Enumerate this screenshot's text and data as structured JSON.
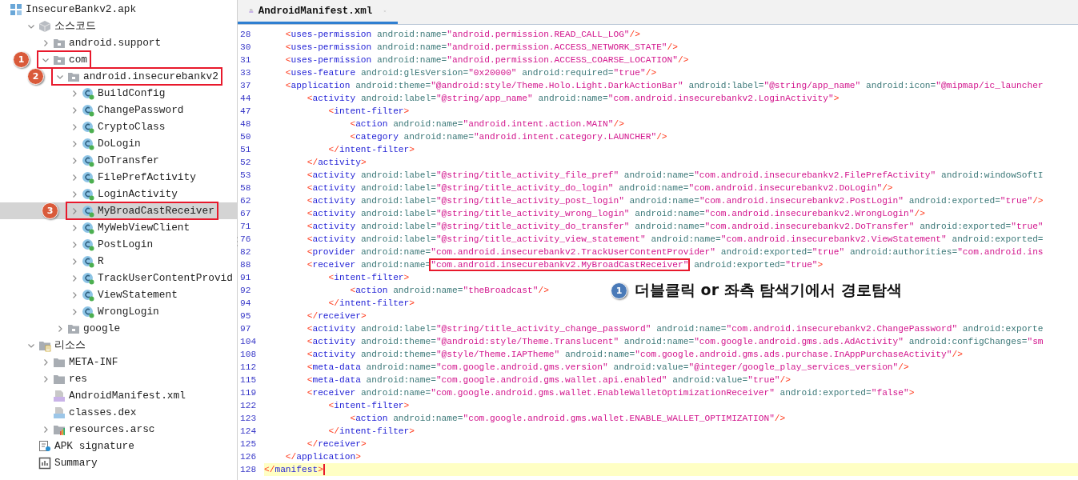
{
  "tree": {
    "label": "InsecureBankv2.apk",
    "kind": "apk",
    "selected": false,
    "children": [
      {
        "label": "소스코드",
        "kind": "sources",
        "selected": false,
        "expanded": true,
        "children": [
          {
            "label": "android.support",
            "kind": "package",
            "selected": false,
            "expanded": false
          },
          {
            "label": "com",
            "kind": "package",
            "selected": false,
            "expanded": true,
            "annotation": "1",
            "children": [
              {
                "label": "android.insecurebankv2",
                "kind": "package",
                "selected": false,
                "expanded": true,
                "annotation": "2",
                "children": [
                  {
                    "label": "BuildConfig",
                    "kind": "class",
                    "selected": false,
                    "expanded": false
                  },
                  {
                    "label": "ChangePassword",
                    "kind": "class",
                    "selected": false,
                    "expanded": false
                  },
                  {
                    "label": "CryptoClass",
                    "kind": "class",
                    "selected": false,
                    "expanded": false
                  },
                  {
                    "label": "DoLogin",
                    "kind": "class",
                    "selected": false,
                    "expanded": false
                  },
                  {
                    "label": "DoTransfer",
                    "kind": "class",
                    "selected": false,
                    "expanded": false
                  },
                  {
                    "label": "FilePrefActivity",
                    "kind": "class",
                    "selected": false,
                    "expanded": false
                  },
                  {
                    "label": "LoginActivity",
                    "kind": "class",
                    "selected": false,
                    "expanded": false
                  },
                  {
                    "label": "MyBroadCastReceiver",
                    "kind": "class",
                    "selected": true,
                    "expanded": false,
                    "annotation": "3"
                  },
                  {
                    "label": "MyWebViewClient",
                    "kind": "class",
                    "selected": false,
                    "expanded": false
                  },
                  {
                    "label": "PostLogin",
                    "kind": "class",
                    "selected": false,
                    "expanded": false
                  },
                  {
                    "label": "R",
                    "kind": "class",
                    "selected": false,
                    "expanded": false
                  },
                  {
                    "label": "TrackUserContentProvid",
                    "kind": "class",
                    "selected": false,
                    "expanded": false
                  },
                  {
                    "label": "ViewStatement",
                    "kind": "class",
                    "selected": false,
                    "expanded": false
                  },
                  {
                    "label": "WrongLogin",
                    "kind": "class",
                    "selected": false,
                    "expanded": false
                  }
                ]
              },
              {
                "label": "google",
                "kind": "package",
                "selected": false,
                "expanded": false
              }
            ]
          }
        ]
      },
      {
        "label": "리소스",
        "kind": "resources",
        "selected": false,
        "expanded": true,
        "children": [
          {
            "label": "META-INF",
            "kind": "folder",
            "selected": false,
            "expanded": false
          },
          {
            "label": "res",
            "kind": "folder",
            "selected": false,
            "expanded": false
          },
          {
            "label": "AndroidManifest.xml",
            "kind": "manifest",
            "selected": false
          },
          {
            "label": "classes.dex",
            "kind": "dex",
            "selected": false
          },
          {
            "label": "resources.arsc",
            "kind": "arsc",
            "selected": false,
            "expanded": false
          }
        ]
      },
      {
        "label": "APK signature",
        "kind": "signature",
        "selected": false
      },
      {
        "label": "Summary",
        "kind": "summary",
        "selected": false
      }
    ]
  },
  "tab": {
    "title": "AndroidManifest.xml",
    "selected": true
  },
  "code": [
    {
      "n": "28",
      "text": "    <uses-permission android:name=\"android.permission.READ_CALL_LOG\"/>",
      "current": false
    },
    {
      "n": "30",
      "text": "    <uses-permission android:name=\"android.permission.ACCESS_NETWORK_STATE\"/>",
      "current": false
    },
    {
      "n": "31",
      "text": "    <uses-permission android:name=\"android.permission.ACCESS_COARSE_LOCATION\"/>",
      "current": false
    },
    {
      "n": "33",
      "text": "    <uses-feature android:glEsVersion=\"0x20000\" android:required=\"true\"/>",
      "current": false
    },
    {
      "n": "37",
      "text": "    <application android:theme=\"@android:style/Theme.Holo.Light.DarkActionBar\" android:label=\"@string/app_name\" android:icon=\"@mipmap/ic_launcher",
      "current": false
    },
    {
      "n": "44",
      "text": "        <activity android:label=\"@string/app_name\" android:name=\"com.android.insecurebankv2.LoginActivity\">",
      "current": false
    },
    {
      "n": "47",
      "text": "            <intent-filter>",
      "current": false
    },
    {
      "n": "48",
      "text": "                <action android:name=\"android.intent.action.MAIN\"/>",
      "current": false
    },
    {
      "n": "50",
      "text": "                <category android:name=\"android.intent.category.LAUNCHER\"/>",
      "current": false
    },
    {
      "n": "51",
      "text": "            </intent-filter>",
      "current": false
    },
    {
      "n": "52",
      "text": "        </activity>",
      "current": false
    },
    {
      "n": "53",
      "text": "        <activity android:label=\"@string/title_activity_file_pref\" android:name=\"com.android.insecurebankv2.FilePrefActivity\" android:windowSoftI",
      "current": false
    },
    {
      "n": "58",
      "text": "        <activity android:label=\"@string/title_activity_do_login\" android:name=\"com.android.insecurebankv2.DoLogin\"/>",
      "current": false
    },
    {
      "n": "62",
      "text": "        <activity android:label=\"@string/title_activity_post_login\" android:name=\"com.android.insecurebankv2.PostLogin\" android:exported=\"true\"/>",
      "current": false
    },
    {
      "n": "67",
      "text": "        <activity android:label=\"@string/title_activity_wrong_login\" android:name=\"com.android.insecurebankv2.WrongLogin\"/>",
      "current": false
    },
    {
      "n": "71",
      "text": "        <activity android:label=\"@string/title_activity_do_transfer\" android:name=\"com.android.insecurebankv2.DoTransfer\" android:exported=\"true\"",
      "current": false
    },
    {
      "n": "76",
      "text": "        <activity android:label=\"@string/title_activity_view_statement\" android:name=\"com.android.insecurebankv2.ViewStatement\" android:exported=",
      "current": false
    },
    {
      "n": "82",
      "text": "        <provider android:name=\"com.android.insecurebankv2.TrackUserContentProvider\" android:exported=\"true\" android:authorities=\"com.android.ins",
      "current": false
    },
    {
      "n": "88",
      "text": "        <receiver android:name=\"com.android.insecurebankv2.MyBroadCastReceiver\" android:exported=\"true\">",
      "current": false,
      "boxed": true
    },
    {
      "n": "91",
      "text": "            <intent-filter>",
      "current": false
    },
    {
      "n": "92",
      "text": "                <action android:name=\"theBroadcast\"/>",
      "current": false,
      "callout": {
        "badge": "1",
        "text": "더블클릭 or 좌측 탐색기에서 경로탐색"
      }
    },
    {
      "n": "94",
      "text": "            </intent-filter>",
      "current": false
    },
    {
      "n": "95",
      "text": "        </receiver>",
      "current": false
    },
    {
      "n": "97",
      "text": "        <activity android:label=\"@string/title_activity_change_password\" android:name=\"com.android.insecurebankv2.ChangePassword\" android:exporte",
      "current": false
    },
    {
      "n": "104",
      "text": "        <activity android:theme=\"@android:style/Theme.Translucent\" android:name=\"com.google.android.gms.ads.AdActivity\" android:configChanges=\"sm",
      "current": false
    },
    {
      "n": "108",
      "text": "        <activity android:theme=\"@style/Theme.IAPTheme\" android:name=\"com.google.android.gms.ads.purchase.InAppPurchaseActivity\"/>",
      "current": false
    },
    {
      "n": "112",
      "text": "        <meta-data android:name=\"com.google.android.gms.version\" android:value=\"@integer/google_play_services_version\"/>",
      "current": false
    },
    {
      "n": "115",
      "text": "        <meta-data android:name=\"com.google.android.gms.wallet.api.enabled\" android:value=\"true\"/>",
      "current": false
    },
    {
      "n": "119",
      "text": "        <receiver android:name=\"com.google.android.gms.wallet.EnableWalletOptimizationReceiver\" android:exported=\"false\">",
      "current": false
    },
    {
      "n": "122",
      "text": "            <intent-filter>",
      "current": false
    },
    {
      "n": "123",
      "text": "                <action android:name=\"com.google.android.gms.wallet.ENABLE_WALLET_OPTIMIZATION\"/>",
      "current": false
    },
    {
      "n": "124",
      "text": "            </intent-filter>",
      "current": false
    },
    {
      "n": "125",
      "text": "        </receiver>",
      "current": false
    },
    {
      "n": "126",
      "text": "    </application>",
      "current": false
    },
    {
      "n": "128",
      "text": "</manifest>",
      "current": true
    }
  ]
}
